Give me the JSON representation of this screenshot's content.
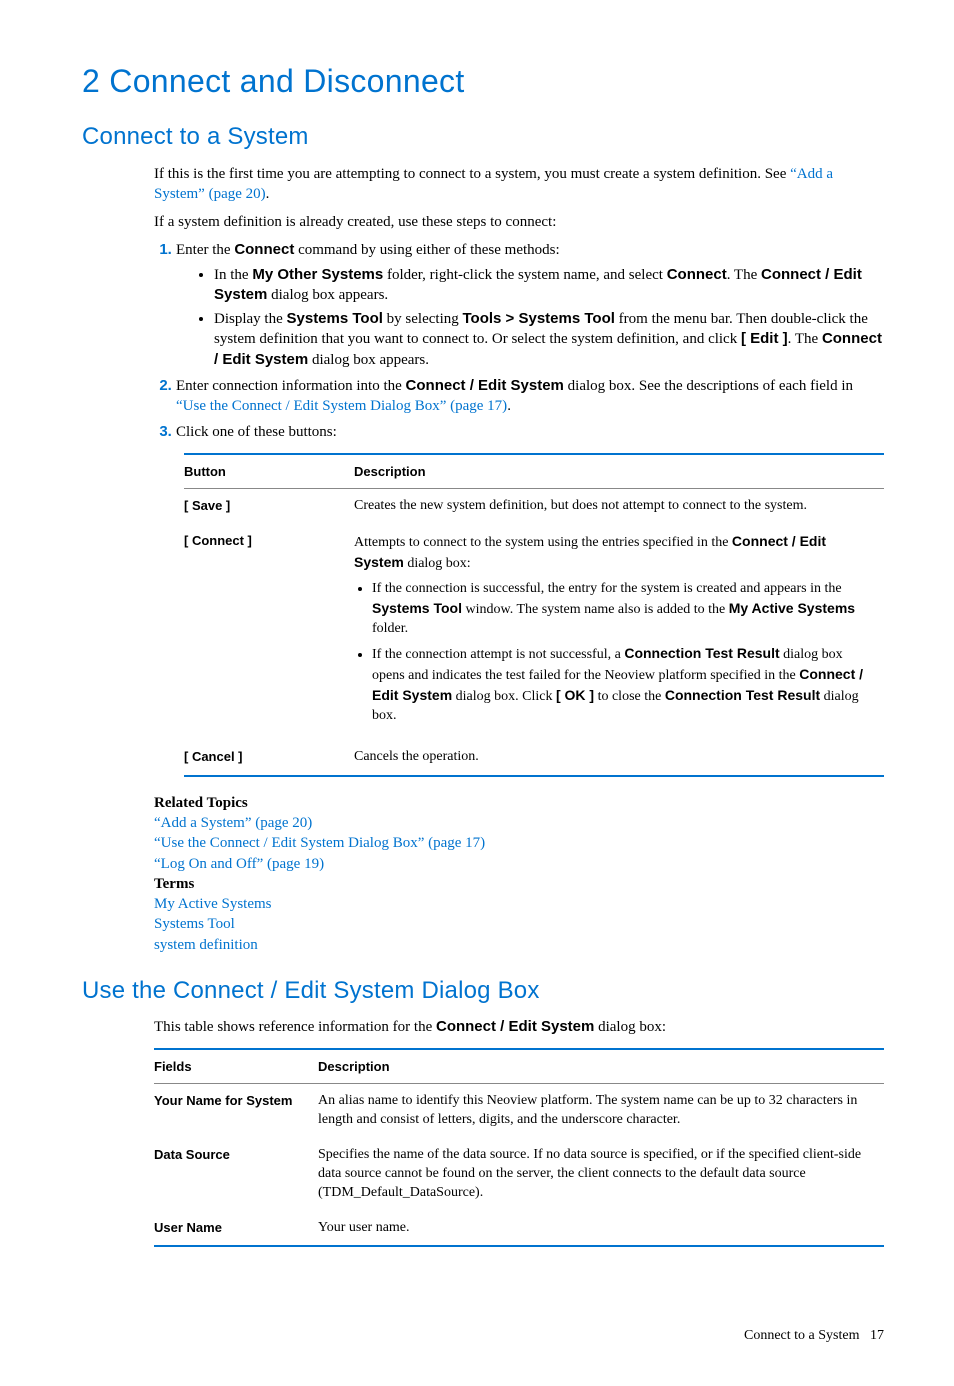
{
  "headings": {
    "h1": "2 Connect and Disconnect",
    "h2a": "Connect to a System",
    "h2b": "Use the Connect / Edit System Dialog Box"
  },
  "intro": {
    "p1a": "If this is the first time you are attempting to connect to a system, you must create a system definition. See ",
    "p1link": "“Add a System” (page 20)",
    "p1b": ".",
    "p2": "If a system definition is already created, use these steps to connect:"
  },
  "steps": {
    "s1_intro_a": "Enter the ",
    "s1_b1": "Connect",
    "s1_intro_b": " command by using either of these methods:",
    "s1_bullet1_a": "In the ",
    "s1_bullet1_b1": "My Other Systems",
    "s1_bullet1_b": " folder, right-click the system name, and select ",
    "s1_bullet1_b2": "Connect",
    "s1_bullet1_c": ". The ",
    "s1_bullet1_b3": "Connect / Edit System",
    "s1_bullet1_d": " dialog box appears.",
    "s1_bullet2_a": "Display the ",
    "s1_bullet2_b1": "Systems Tool",
    "s1_bullet2_b": " by selecting ",
    "s1_bullet2_b2": "Tools > Systems Tool",
    "s1_bullet2_c": " from the menu bar. Then double-click the system definition that you want to connect to. Or select the system definition, and click ",
    "s1_bullet2_b3": "[ Edit ]",
    "s1_bullet2_d": ". The ",
    "s1_bullet2_b4": "Connect / Edit System",
    "s1_bullet2_e": " dialog box appears.",
    "s2_a": "Enter connection information into the ",
    "s2_b1": "Connect / Edit System",
    "s2_b": " dialog box. See the descriptions of each field in ",
    "s2_link": "“Use the Connect / Edit System Dialog Box” (page 17)",
    "s2_c": ".",
    "s3": "Click one of these buttons:"
  },
  "table1": {
    "head_button": "Button",
    "head_desc": "Description",
    "rows": [
      {
        "button": "[ Save ]",
        "desc_plain": "Creates the new system definition, but does not attempt to connect to the system."
      },
      {
        "button": "[ Connect ]",
        "desc_intro_a": "Attempts to connect to the system using the entries specified in the ",
        "desc_intro_b1": "Connect / Edit System",
        "desc_intro_b": " dialog box:",
        "li1_a": "If the connection is successful, the entry for the system is created and appears in the ",
        "li1_b1": "Systems Tool",
        "li1_b": " window. The system name also is added to the ",
        "li1_b2": "My Active Systems",
        "li1_c": " folder.",
        "li2_a": "If the connection attempt is not successful, a ",
        "li2_b1": "Connection Test Result",
        "li2_b": " dialog box opens and indicates the test failed for the Neoview platform specified in the ",
        "li2_b2": "Connect / Edit System",
        "li2_c": " dialog box. Click ",
        "li2_b3": "[ OK ]",
        "li2_d": " to close the ",
        "li2_b4": "Connection Test Result",
        "li2_e": " dialog box."
      },
      {
        "button": "[ Cancel ]",
        "desc_plain": "Cancels the operation."
      }
    ]
  },
  "related": {
    "title": "Related Topics",
    "links": [
      "“Add a System” (page 20)",
      "“Use the Connect / Edit System Dialog Box” (page 17)",
      "“Log On and Off” (page 19)"
    ],
    "terms_title": "Terms",
    "terms": [
      "My Active Systems",
      "Systems Tool",
      "system definition"
    ]
  },
  "section2_intro_a": "This table shows reference information for the ",
  "section2_intro_b1": "Connect / Edit System",
  "section2_intro_b": " dialog box:",
  "table2": {
    "head_fields": "Fields",
    "head_desc": "Description",
    "rows": [
      {
        "field": "Your Name for System",
        "desc": "An alias name to identify this Neoview platform. The system name can be up to 32 characters in length and consist of letters, digits, and the underscore character."
      },
      {
        "field": "Data Source",
        "desc": "Specifies the name of the data source. If no data source is specified, or if the specified client-side data source cannot be found on the server, the client connects to the default data source (TDM_Default_DataSource)."
      },
      {
        "field": "User Name",
        "desc": "Your user name."
      }
    ]
  },
  "footer": {
    "label": "Connect to a System",
    "page": "17"
  }
}
